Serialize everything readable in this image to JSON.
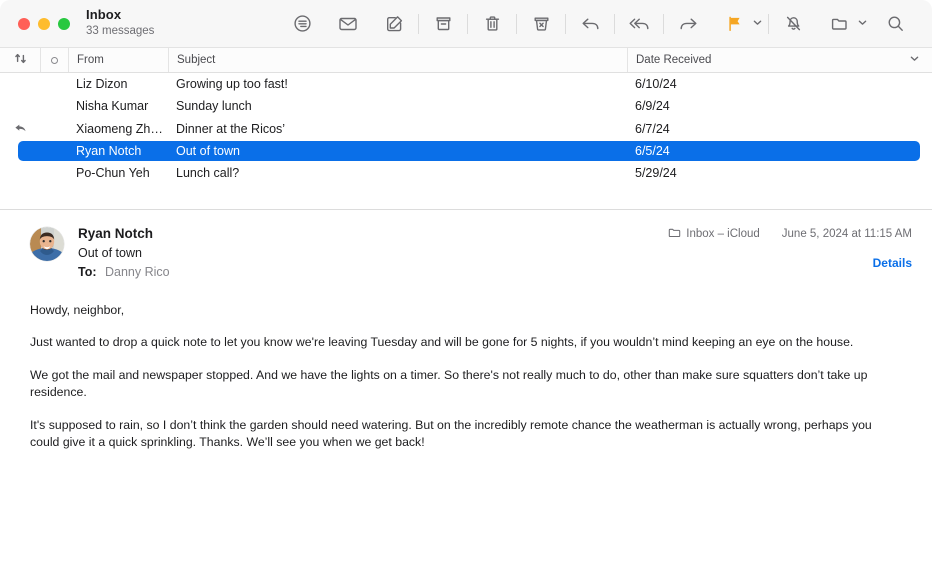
{
  "window": {
    "traffic_lights": [
      "close",
      "minimize",
      "zoom"
    ],
    "colors": {
      "close": "#ff5f57",
      "minimize": "#febc2e",
      "zoom": "#28c840",
      "selection_blue": "#0a6fe8",
      "link_blue": "#0a6fe8",
      "flag_orange": "#f5a623"
    }
  },
  "header": {
    "mailbox_name": "Inbox",
    "message_count": "33 messages"
  },
  "toolbar": {
    "buttons": [
      {
        "name": "filter-icon",
        "label": "Filter"
      },
      {
        "name": "mark-unread-icon",
        "label": "Mark as Unread"
      },
      {
        "name": "compose-icon",
        "label": "New Message"
      },
      {
        "name": "archive-icon",
        "label": "Archive"
      },
      {
        "name": "delete-icon",
        "label": "Delete"
      },
      {
        "name": "junk-icon",
        "label": "Move to Junk"
      },
      {
        "name": "reply-icon",
        "label": "Reply"
      },
      {
        "name": "reply-all-icon",
        "label": "Reply All"
      },
      {
        "name": "forward-icon",
        "label": "Forward"
      },
      {
        "name": "flag-icon",
        "label": "Flag"
      },
      {
        "name": "mute-icon",
        "label": "Mute"
      },
      {
        "name": "move-icon",
        "label": "Move To"
      },
      {
        "name": "search-icon",
        "label": "Search"
      }
    ]
  },
  "message_list": {
    "columns": {
      "sort": "sort-icon",
      "unread": "unread-dot",
      "from": "From",
      "subject": "Subject",
      "date": "Date Received"
    },
    "rows": [
      {
        "from": "Liz Dizon",
        "subject": "Growing up too fast!",
        "date": "6/10/24",
        "replied": false,
        "selected": false
      },
      {
        "from": "Nisha Kumar",
        "subject": "Sunday lunch",
        "date": "6/9/24",
        "replied": false,
        "selected": false
      },
      {
        "from": "Xiaomeng Zh…",
        "subject": "Dinner at the Ricos’",
        "date": "6/7/24",
        "replied": true,
        "selected": false
      },
      {
        "from": "Ryan Notch",
        "subject": "Out of town",
        "date": "6/5/24",
        "replied": false,
        "selected": true
      },
      {
        "from": "Po-Chun Yeh",
        "subject": "Lunch call?",
        "date": "5/29/24",
        "replied": false,
        "selected": false
      }
    ]
  },
  "message": {
    "sender": "Ryan Notch",
    "subject": "Out of town",
    "to_label": "To:",
    "to_value": "Danny Rico",
    "mailbox": "Inbox – iCloud",
    "date": "June 5, 2024 at 11:15 AM",
    "details_label": "Details",
    "body": [
      "Howdy, neighbor,",
      "Just wanted to drop a quick note to let you know we're leaving Tuesday and will be gone for 5 nights, if you wouldn’t mind keeping an eye on the house.",
      "We got the mail and newspaper stopped. And we have the lights on a timer. So there's not really much to do, other than make sure squatters don’t take up residence.",
      "It's supposed to rain, so I don’t think the garden should need watering. But on the incredibly remote chance the weatherman is actually wrong, perhaps you could give it a quick sprinkling. Thanks. We’ll see you when we get back!"
    ]
  }
}
